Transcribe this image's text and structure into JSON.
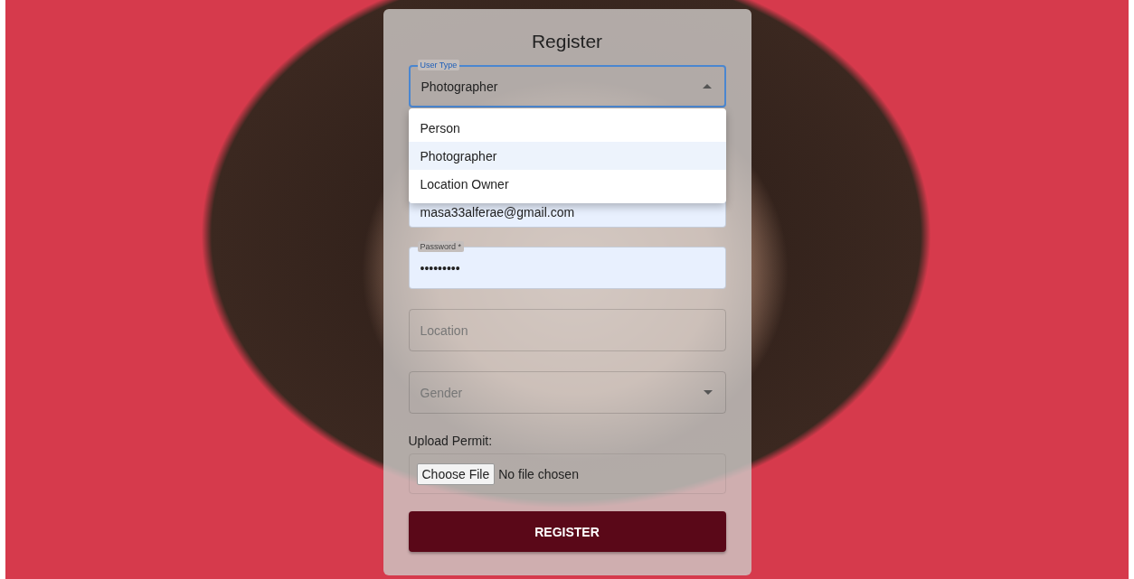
{
  "title": "Register",
  "user_type": {
    "label": "User Type",
    "value": "Photographer",
    "expanded": true,
    "options": [
      {
        "label": "Person",
        "selected": false
      },
      {
        "label": "Photographer",
        "selected": true
      },
      {
        "label": "Location Owner",
        "selected": false
      }
    ]
  },
  "fields": [
    {
      "kind": "text",
      "value": "masa33alferae@gmail.com",
      "filled": true
    },
    {
      "kind": "text",
      "label": "Password *",
      "value": "•••••••••",
      "filled": true
    },
    {
      "kind": "text",
      "placeholder": "Location",
      "filled": false
    },
    {
      "kind": "select",
      "placeholder": "Gender",
      "filled": false
    }
  ],
  "upload": {
    "label": "Upload Permit:",
    "button": "Choose File",
    "status": "No file chosen"
  },
  "submit": "REGISTER"
}
